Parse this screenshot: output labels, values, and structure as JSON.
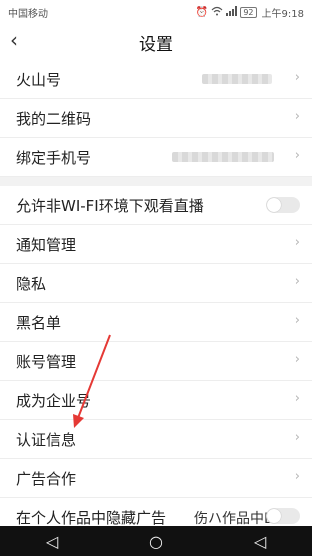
{
  "status_bar": {
    "carrier": "中国移动",
    "battery": "92",
    "time": "上午9:18"
  },
  "header": {
    "back_glyph": "‹",
    "title": "设置"
  },
  "settings": {
    "items": [
      {
        "label": "火山号"
      },
      {
        "label": "我的二维码"
      },
      {
        "label": "绑定手机号"
      },
      {
        "label": "允许非WI-FI环境下观看直播",
        "toggle_state": "off"
      },
      {
        "label": "通知管理"
      },
      {
        "label": "隐私"
      },
      {
        "label": "黑名单"
      },
      {
        "label": "账号管理"
      },
      {
        "label": "成为企业号"
      },
      {
        "label": "认证信息"
      },
      {
        "label": "广告合作"
      },
      {
        "label": "在个人作品中隐藏广告"
      }
    ],
    "partial_text": "伤ハ作品中B"
  },
  "nav_buttons": {
    "back": "◁",
    "home": "○",
    "recent": "◁"
  },
  "colors": {
    "background": "#ffffff",
    "section_gap": "#f2f2f2",
    "annotation_arrow": "#e53935",
    "nav_bar": "#111111"
  },
  "icons": [
    "alarm-icon",
    "wifi-icon",
    "signal-icon",
    "chevron-right-icon"
  ]
}
